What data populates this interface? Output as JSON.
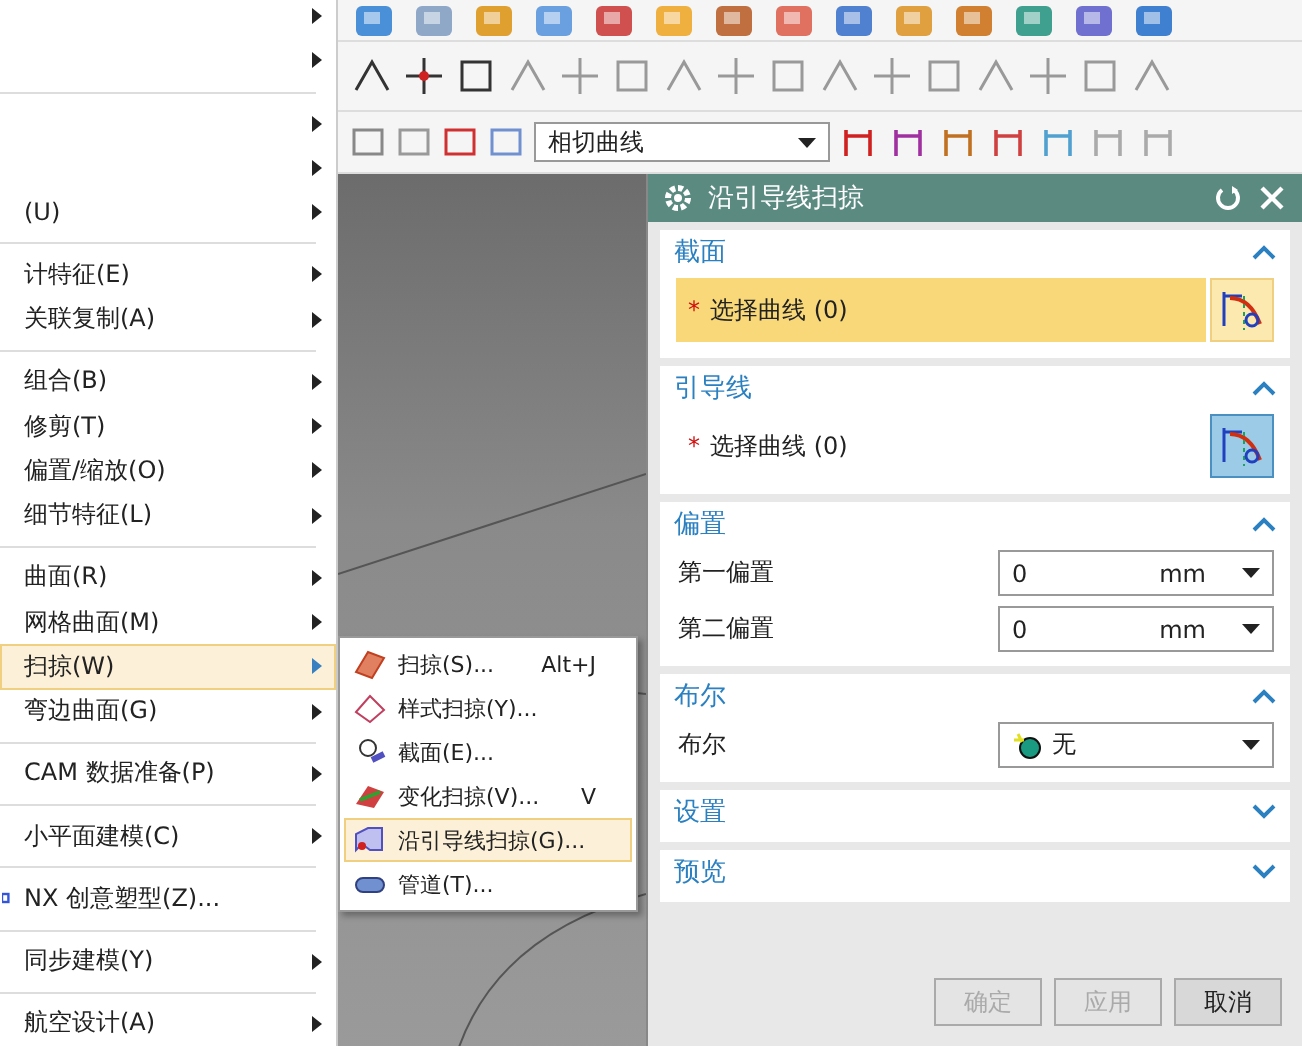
{
  "main_menu": {
    "groups": [
      [
        {
          "kind": "submenu",
          "selected": false
        },
        {
          "kind": "submenu",
          "selected": false
        }
      ],
      [
        {
          "kind": "submenu",
          "selected": false
        },
        {
          "kind": "submenu",
          "selected": false
        },
        {
          "label": "(U)",
          "kind": "submenu",
          "selected": false
        }
      ],
      [
        {
          "label": "计特征(E)",
          "kind": "submenu",
          "selected": false
        },
        {
          "label": "关联复制(A)",
          "kind": "submenu",
          "selected": false
        }
      ],
      [
        {
          "label": "组合(B)",
          "kind": "submenu",
          "selected": false
        },
        {
          "label": "修剪(T)",
          "kind": "submenu",
          "selected": false
        },
        {
          "label": "偏置/缩放(O)",
          "kind": "submenu",
          "selected": false
        },
        {
          "label": "细节特征(L)",
          "kind": "submenu",
          "selected": false
        }
      ],
      [
        {
          "label": "曲面(R)",
          "kind": "submenu",
          "selected": false
        },
        {
          "label": "网格曲面(M)",
          "kind": "submenu",
          "selected": false
        },
        {
          "label": "扫掠(W)",
          "kind": "submenu",
          "selected": true
        },
        {
          "label": "弯边曲面(G)",
          "kind": "submenu",
          "selected": false
        }
      ],
      [
        {
          "label": "CAM 数据准备(P)",
          "kind": "submenu",
          "selected": false
        }
      ],
      [
        {
          "label": "小平面建模(C)",
          "kind": "submenu",
          "selected": false
        }
      ],
      [
        {
          "label": "NX 创意塑型(Z)...",
          "kind": "command",
          "selected": false
        }
      ],
      [
        {
          "label": "同步建模(Y)",
          "kind": "submenu",
          "selected": false
        }
      ],
      [
        {
          "label": "航空设计(A)",
          "kind": "submenu",
          "selected": false
        }
      ]
    ]
  },
  "toolbar": {
    "curve_type": "相切曲线"
  },
  "sweep_submenu": [
    {
      "label": "扫掠(S)...",
      "shortcut": "Alt+J",
      "selected": false
    },
    {
      "label": "样式扫掠(Y)...",
      "selected": false
    },
    {
      "label": "截面(E)...",
      "selected": false
    },
    {
      "label": "变化扫掠(V)...",
      "shortcut": "V",
      "selected": false
    },
    {
      "label": "沿引导线扫掠(G)...",
      "selected": true
    },
    {
      "label": "管道(T)...",
      "selected": false
    }
  ],
  "dialog": {
    "title": "沿引导线扫掠",
    "sections": [
      {
        "kind": "select",
        "title": "截面",
        "expanded": true,
        "required_mark": "*",
        "label": "选择曲线 (0)",
        "active": true
      },
      {
        "kind": "select",
        "title": "引导线",
        "expanded": true,
        "required_mark": "*",
        "label": "选择曲线 (0)",
        "active": false
      },
      {
        "kind": "fields",
        "title": "偏置",
        "expanded": true,
        "fields": [
          {
            "label": "第一偏置",
            "value": "0",
            "unit": "mm"
          },
          {
            "label": "第二偏置",
            "value": "0",
            "unit": "mm"
          }
        ]
      },
      {
        "kind": "combo",
        "title": "布尔",
        "expanded": true,
        "label": "布尔",
        "value": "无"
      },
      {
        "title": "设置",
        "expanded": false
      },
      {
        "title": "预览",
        "expanded": false
      }
    ],
    "buttons": [
      {
        "label": "确定",
        "disabled": true
      },
      {
        "label": "应用",
        "disabled": true
      },
      {
        "label": "取消",
        "disabled": false
      }
    ]
  }
}
